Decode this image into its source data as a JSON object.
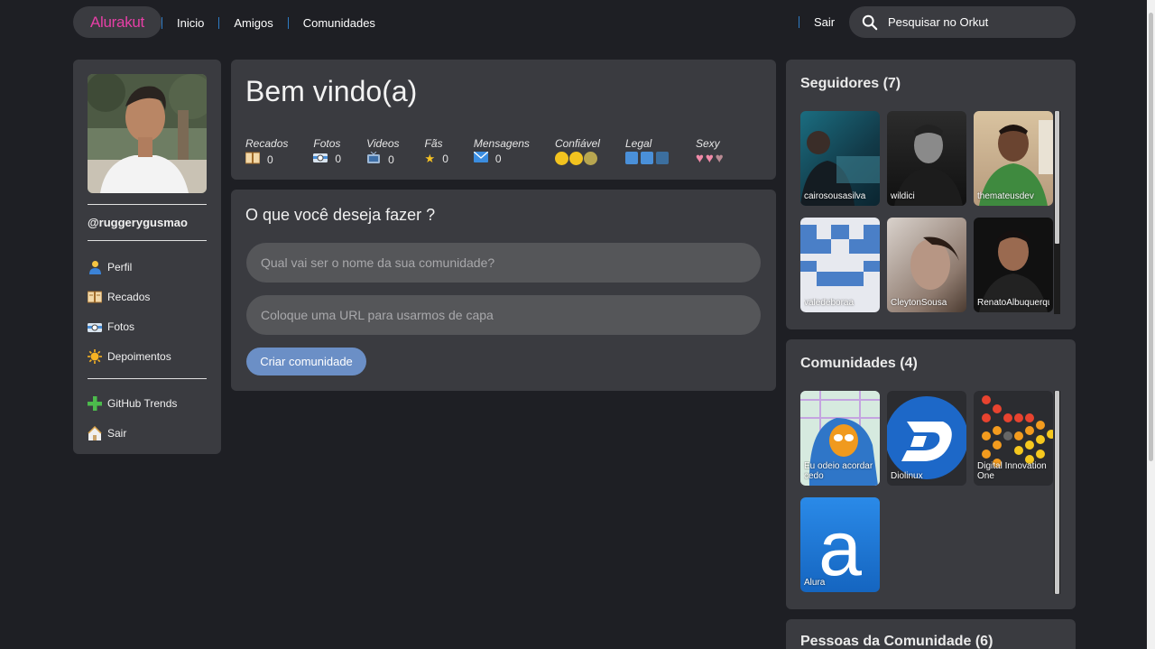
{
  "header": {
    "logo": "Alurakut",
    "nav": [
      "Inicio",
      "Amigos",
      "Comunidades"
    ],
    "logout": "Sair",
    "search_placeholder": "Pesquisar no Orkut",
    "search_icon": "search-icon"
  },
  "profile": {
    "username": "@ruggerygusmao",
    "menu": [
      {
        "label": "Perfil",
        "icon": "user-icon"
      },
      {
        "label": "Recados",
        "icon": "book-icon"
      },
      {
        "label": "Fotos",
        "icon": "camera-icon"
      },
      {
        "label": "Depoimentos",
        "icon": "sun-icon"
      }
    ],
    "menu2": [
      {
        "label": "GitHub Trends",
        "icon": "plus-icon"
      },
      {
        "label": "Sair",
        "icon": "logout-house-icon"
      }
    ]
  },
  "welcome": {
    "title": "Bem vindo(a)",
    "stats": [
      {
        "label": "Recados",
        "value": "0"
      },
      {
        "label": "Fotos",
        "value": "0"
      },
      {
        "label": "Videos",
        "value": "0"
      },
      {
        "label": "Fãs",
        "value": "0"
      },
      {
        "label": "Mensagens",
        "value": "0"
      }
    ],
    "ratings": [
      {
        "label": "Confiável",
        "icon": "smiley-icon"
      },
      {
        "label": "Legal",
        "icon": "cube-icon"
      },
      {
        "label": "Sexy",
        "icon": "heart-icon"
      }
    ]
  },
  "create": {
    "title": "O que você deseja fazer ?",
    "name_placeholder": "Qual vai ser o nome da sua comunidade?",
    "url_placeholder": "Coloque uma URL para usarmos de capa",
    "button": "Criar comunidade"
  },
  "followers": {
    "title": "Seguidores (7)",
    "items": [
      "cairosousasilva",
      "wildici",
      "themateusdev",
      "valedeboraa",
      "CleytonSousa",
      "RenatoAlbuquerque"
    ]
  },
  "communities": {
    "title": "Comunidades (4)",
    "items": [
      "Eu odeio acordar cedo",
      "Diolinux",
      "Digital Innovation One",
      "Alura"
    ]
  },
  "people": {
    "title": "Pessoas da Comunidade (6)"
  },
  "colors": {
    "background": "#1e1f24",
    "panel": "#3a3b40",
    "logo_pink": "#e63fa6",
    "button_blue": "#6b8fc6",
    "nav_separator": "#2e7bc4"
  }
}
